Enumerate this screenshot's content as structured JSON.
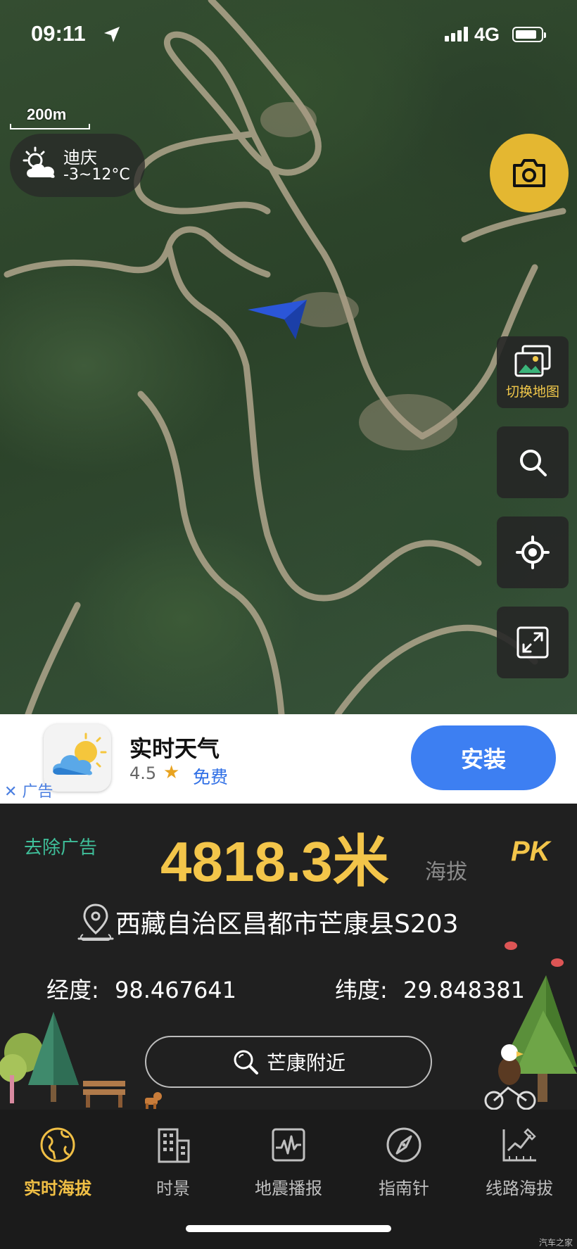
{
  "status_bar": {
    "time": "09:11",
    "network": "4G"
  },
  "map": {
    "scale_label": "200m",
    "weather": {
      "city": "迪庆",
      "temp": "-3~12°C",
      "icon": "partly-cloudy-icon"
    },
    "side_buttons": {
      "switch_map_label": "切换地图"
    },
    "colors": {
      "camera_button": "#e4b731",
      "nav_arrow": "#2b56d8"
    }
  },
  "ad": {
    "app_name": "实时天气",
    "rating": "4.5",
    "price": "免费",
    "install_label": "安装",
    "ad_label": "广告",
    "close_symbol": "✕"
  },
  "info": {
    "remove_ad": "去除广告",
    "altitude": "4818.3米",
    "altitude_label": "海拔",
    "pk_label": "PK",
    "address": "西藏自治区昌都市芒康县S203",
    "longitude_label": "经度:",
    "longitude": "98.467641",
    "latitude_label": "纬度:",
    "latitude": "29.848381",
    "nearby_label": "芒康附近"
  },
  "tabbar": {
    "tabs": [
      {
        "label": "实时海拔",
        "icon": "globe-icon",
        "active": true
      },
      {
        "label": "时景",
        "icon": "building-icon",
        "active": false
      },
      {
        "label": "地震播报",
        "icon": "seismograph-icon",
        "active": false
      },
      {
        "label": "指南针",
        "icon": "compass-icon",
        "active": false
      },
      {
        "label": "线路海拔",
        "icon": "route-chart-icon",
        "active": false
      }
    ]
  },
  "watermark": "汽车之家"
}
